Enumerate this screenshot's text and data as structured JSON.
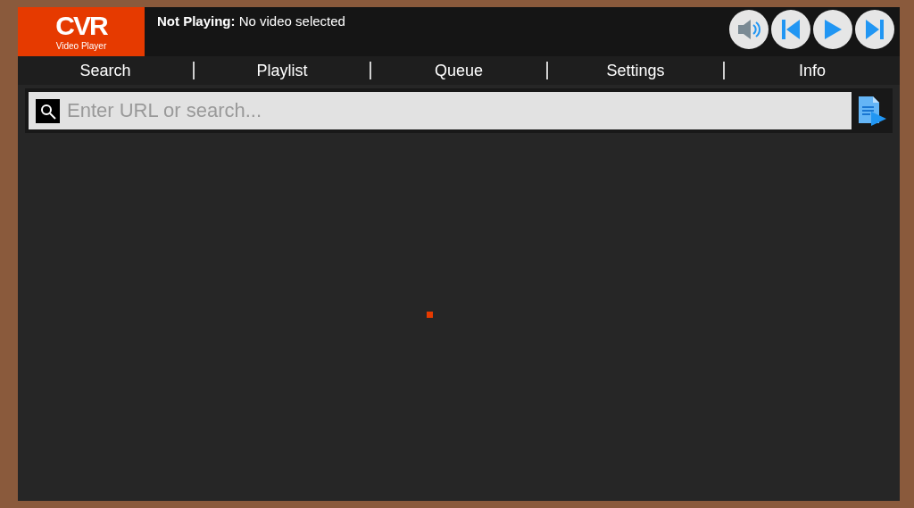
{
  "logo": {
    "mark": "CVR",
    "caption": "Video Player"
  },
  "status": {
    "label": "Not Playing:",
    "text": "No video selected"
  },
  "tabs": [
    {
      "label": "Search"
    },
    {
      "label": "Playlist"
    },
    {
      "label": "Queue"
    },
    {
      "label": "Settings"
    },
    {
      "label": "Info"
    }
  ],
  "search": {
    "placeholder": "Enter URL or search..."
  }
}
